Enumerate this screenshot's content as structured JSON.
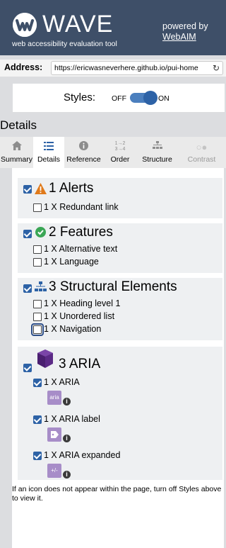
{
  "header": {
    "logo_text": "WAVE",
    "tagline": "web accessibility evaluation tool",
    "powered_by": "powered by",
    "powered_link": "WebAIM"
  },
  "address": {
    "label": "Address:",
    "value": "https://ericwasneverhere.github.io/pui-home"
  },
  "styles": {
    "label": "Styles:",
    "off": "OFF",
    "on": "ON",
    "enabled": true
  },
  "details_title": "Details",
  "tabs": [
    {
      "label": "Summary",
      "icon": "home-icon"
    },
    {
      "label": "Details",
      "icon": "list-icon",
      "active": true
    },
    {
      "label": "Reference",
      "icon": "info-icon"
    },
    {
      "label": "Order",
      "icon": "order-icon"
    },
    {
      "label": "Structure",
      "icon": "structure-icon"
    },
    {
      "label": "Contrast",
      "icon": "contrast-icon",
      "disabled": true
    }
  ],
  "groups": {
    "alerts": {
      "count": "1",
      "title": "Alerts",
      "items": [
        {
          "text": "1 X Redundant link",
          "checked": false
        }
      ]
    },
    "features": {
      "count": "2",
      "title": "Features",
      "items": [
        {
          "text": "1 X Alternative text",
          "checked": false
        },
        {
          "text": "1 X Language",
          "checked": false
        }
      ]
    },
    "structural": {
      "count": "3",
      "title": "Structural Elements",
      "items": [
        {
          "text": "1 X Heading level 1",
          "checked": false
        },
        {
          "text": "1 X Unordered list",
          "checked": false
        },
        {
          "text": "1 X Navigation",
          "checked": false
        }
      ]
    },
    "aria": {
      "count": "3",
      "title": "ARIA",
      "items": [
        {
          "text": "1 X ARIA",
          "checked": true,
          "badge": "aria"
        },
        {
          "text": "1 X ARIA label",
          "checked": true
        },
        {
          "text": "1 X ARIA expanded",
          "checked": true,
          "badge": "+/-"
        }
      ]
    }
  },
  "info_glyph": "i",
  "footer_note": "If an icon does not appear within the page, turn off Styles above to view it.",
  "colors": {
    "header_bg": "#3e4f68",
    "accent": "#2d62a6",
    "alert": "#e07a1b",
    "feature": "#3aa655",
    "aria": "#5b2a86",
    "aria_badge": "#a78dc8"
  }
}
